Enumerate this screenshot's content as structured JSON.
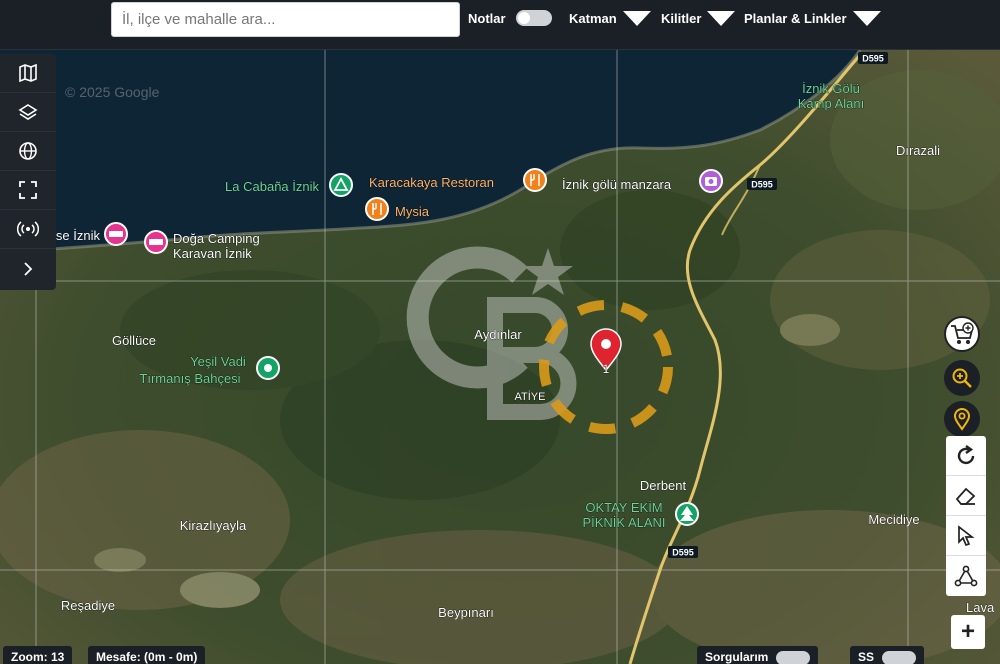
{
  "search": {
    "placeholder": "İl, ilçe ve mahalle ara..."
  },
  "toolbar": {
    "notes_label": "Notlar",
    "layer_label": "Katman",
    "locks_label": "Kilitler",
    "plans_label": "Planlar & Linkler"
  },
  "map": {
    "copyright": "© 2025 Google",
    "marker_number": "1",
    "places": {
      "iznik_golu_kamp_1": "İznik Gölü",
      "iznik_golu_kamp_2": "Kamp Alanı",
      "dirazali": "Dırazali",
      "la_cabana": "La Cabaña İznik",
      "karacakaya": "Karacakaya Restoran",
      "iznik_golu_manzara": "İznik gölü manzara",
      "mysia": "Mysia",
      "house_iznik": "k House İznik",
      "doga_camping_1": "Doğa Camping",
      "doga_camping_2": "Karavan İznik",
      "gollüce": "Göllüce",
      "yesil_vadi_1": "Yeşil Vadi",
      "yesil_vadi_2": "Tırmanış Bahçesi",
      "aydinlar": "Aydınlar",
      "atiye": "ATİYE",
      "derbent": "Derbent",
      "oktay_1": "OKTAY EKİM",
      "oktay_2": "PİKNİK ALANI",
      "mecidiye": "Mecidiye",
      "kirazliyayla": "Kirazlıyayla",
      "resadiye": "Reşadiye",
      "beypinari": "Beypınarı",
      "lava": "Lava"
    },
    "roads": {
      "d595_a": "D595",
      "d595_b": "D595",
      "d595_c": "D595"
    }
  },
  "status": {
    "zoom": "Zoom: 13",
    "distance": "Mesafe: (0m - 0m)",
    "queries_label": "Sorgularım",
    "ss_label": "SS"
  },
  "colors": {
    "water": "#0e2536",
    "land": "#3f4f2c",
    "road": "#e2c46b",
    "marker_red": "#e0242f",
    "dashed_circle": "#d99a1a",
    "poi_green": "#14a366",
    "poi_orange": "#f2811b",
    "poi_purple": "#b05fd8",
    "poi_pink": "#e8338e",
    "accent_yellow": "#f2b705",
    "bar_bg": "#1b1f26"
  },
  "icons": {
    "left": [
      "map-icon",
      "layers-icon",
      "globe-icon",
      "fullscreen-icon",
      "broadcast-icon",
      "chevron-right-icon"
    ],
    "right": [
      "cart-plus-icon",
      "zoom-in-icon",
      "location-pin-icon",
      "refresh-icon",
      "eraser-icon",
      "pointer-icon",
      "polygon-icon",
      "plus-icon"
    ]
  }
}
